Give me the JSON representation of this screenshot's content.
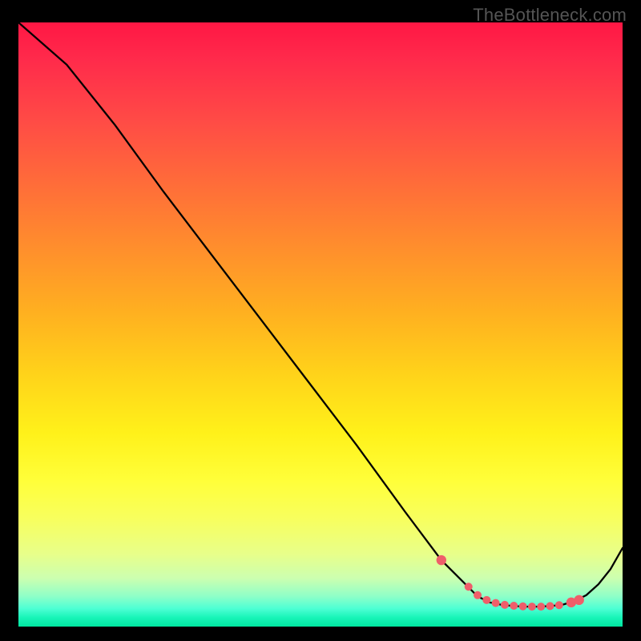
{
  "watermark": "TheBottleneck.com",
  "chart_data": {
    "type": "line",
    "title": "",
    "xlabel": "",
    "ylabel": "",
    "xlim": [
      0,
      100
    ],
    "ylim": [
      0,
      100
    ],
    "series": [
      {
        "name": "curve",
        "x": [
          0,
          8,
          16,
          24,
          32,
          40,
          48,
          56,
          64,
          70,
          74,
          76,
          78,
          80,
          82,
          84,
          86,
          88,
          90,
          92,
          94,
          96,
          98,
          100
        ],
        "y": [
          100,
          93,
          83,
          72,
          61.5,
          51,
          40.5,
          30,
          19,
          11,
          7,
          5,
          4,
          3.6,
          3.4,
          3.3,
          3.3,
          3.4,
          3.6,
          4.2,
          5.2,
          7,
          9.5,
          13
        ]
      }
    ],
    "markers": {
      "name": "highlight-points",
      "color": "#ef5e6a",
      "x": [
        70,
        74.5,
        76,
        77.5,
        79,
        80.5,
        82,
        83.5,
        85,
        86.5,
        88,
        89.5,
        91.5,
        92.8
      ],
      "y": [
        11,
        6.6,
        5.2,
        4.4,
        3.9,
        3.6,
        3.45,
        3.35,
        3.3,
        3.3,
        3.4,
        3.55,
        4.0,
        4.4
      ]
    },
    "gradient_stops": [
      {
        "pos": 0.0,
        "color": "#ff1744"
      },
      {
        "pos": 0.16,
        "color": "#ff4a46"
      },
      {
        "pos": 0.36,
        "color": "#ff8a2e"
      },
      {
        "pos": 0.58,
        "color": "#ffd21a"
      },
      {
        "pos": 0.76,
        "color": "#ffff3a"
      },
      {
        "pos": 0.92,
        "color": "#ccffb0"
      },
      {
        "pos": 1.0,
        "color": "#00e6a0"
      }
    ]
  }
}
